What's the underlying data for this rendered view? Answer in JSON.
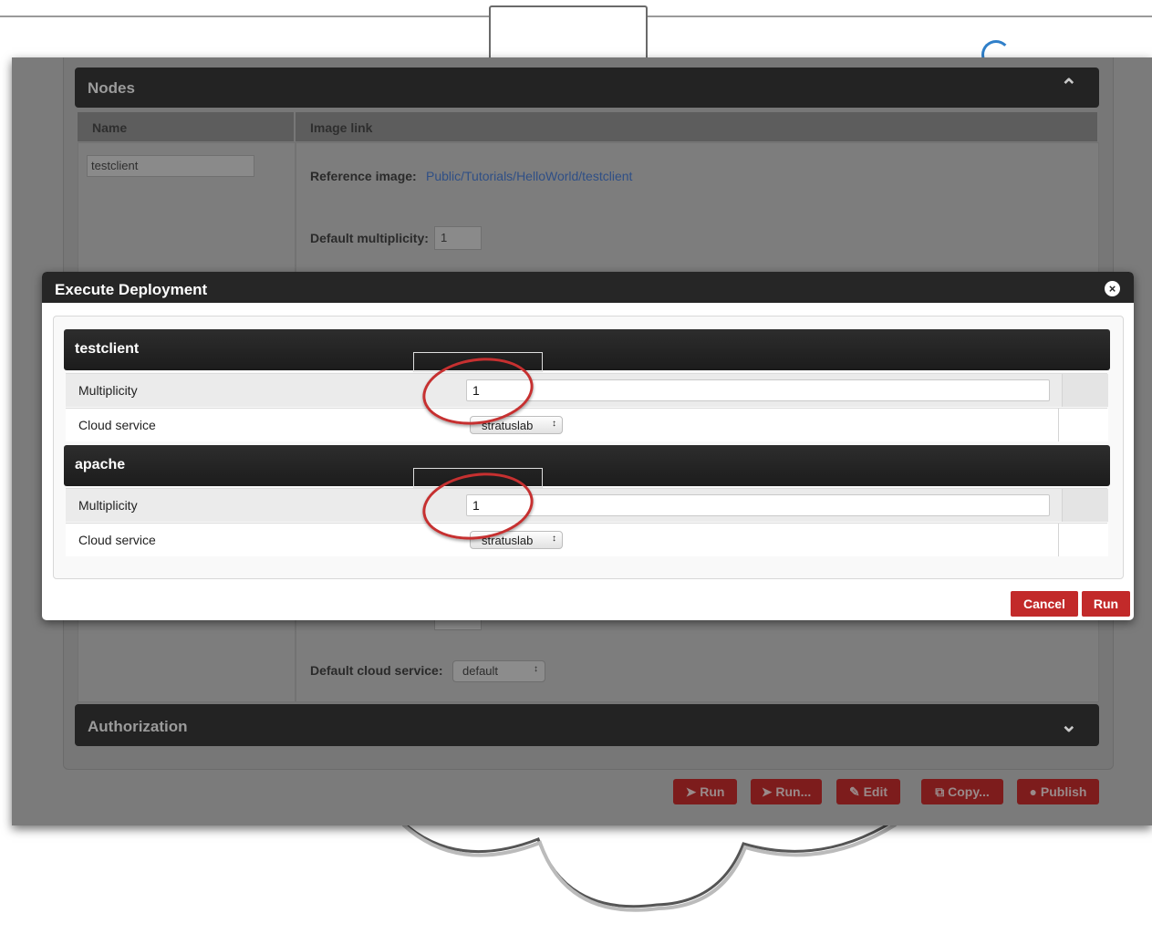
{
  "background_page": {
    "nodes_section": {
      "title": "Nodes",
      "columns": [
        "Name",
        "Image link"
      ],
      "node_name": "testclient",
      "reference_image_label": "Reference image:",
      "reference_image_link": "Public/Tutorials/HelloWorld/testclient",
      "default_multiplicity_label": "Default multiplicity:",
      "default_multiplicity_value": "1",
      "default_cloud_service_label": "Default cloud service:",
      "default_cloud_service_value": "default"
    },
    "authorization_title": "Authorization",
    "action_buttons": [
      "Run",
      "Run...",
      "Edit",
      "Copy...",
      "Publish"
    ]
  },
  "modal": {
    "title": "Execute Deployment",
    "nodes": [
      {
        "name": "testclient",
        "multiplicity_label": "Multiplicity",
        "multiplicity_value": "1",
        "cloud_service_label": "Cloud service",
        "cloud_service_value": "stratuslab"
      },
      {
        "name": "apache",
        "multiplicity_label": "Multiplicity",
        "multiplicity_value": "1",
        "cloud_service_label": "Cloud service",
        "cloud_service_value": "stratuslab"
      }
    ],
    "cancel_label": "Cancel",
    "run_label": "Run"
  },
  "colors": {
    "accent_red": "#c22a2a",
    "header_dark": "#262626",
    "link_blue": "#2f4f86",
    "highlight_ring": "#c63030"
  }
}
